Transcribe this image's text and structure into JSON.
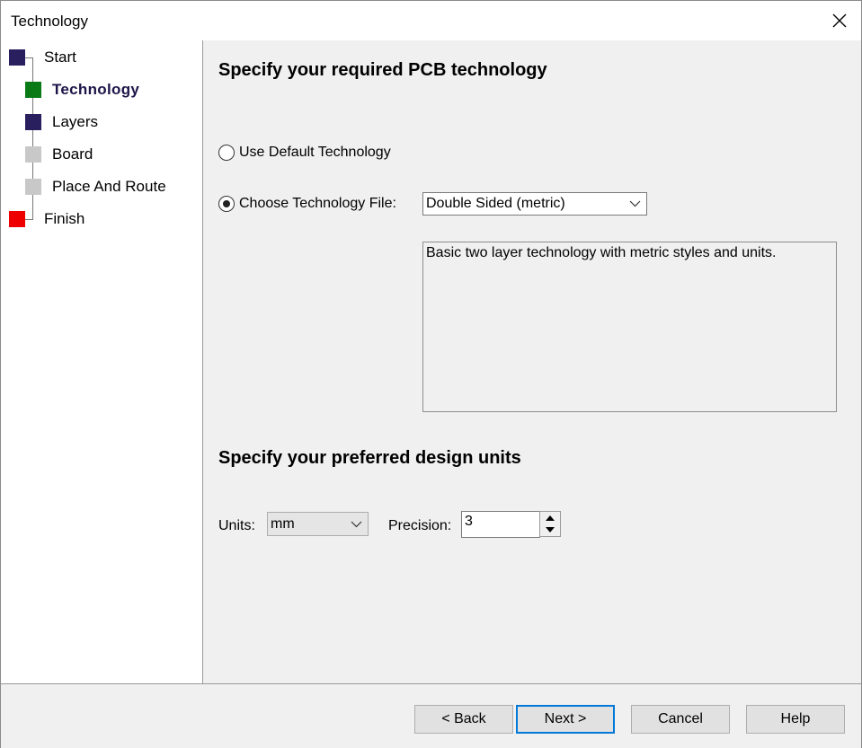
{
  "window": {
    "title": "Technology"
  },
  "nav": {
    "items": [
      {
        "label": "Start",
        "color": "#2a1f5e"
      },
      {
        "label": "Technology",
        "color": "#0a7a16"
      },
      {
        "label": "Layers",
        "color": "#2a1f5e"
      },
      {
        "label": "Board",
        "color": "#c8c8c8"
      },
      {
        "label": "Place And Route",
        "color": "#c8c8c8"
      },
      {
        "label": "Finish",
        "color": "#ee0000"
      }
    ],
    "active": "Technology"
  },
  "technology": {
    "heading": "Specify your required PCB technology",
    "option_default": "Use Default Technology",
    "option_file": "Choose Technology File:",
    "selected_option": "file",
    "file_value": "Double Sided (metric)",
    "description": "Basic two layer technology with metric styles and units."
  },
  "units": {
    "heading": "Specify your preferred design units",
    "units_label": "Units:",
    "units_value": "mm",
    "precision_label": "Precision:",
    "precision_value": "3"
  },
  "footer": {
    "back_label": "< Back",
    "next_label": "Next >",
    "cancel_label": "Cancel",
    "help_label": "Help"
  },
  "colors": {
    "accent": "#0078d7",
    "panel": "#f0f0f0"
  }
}
